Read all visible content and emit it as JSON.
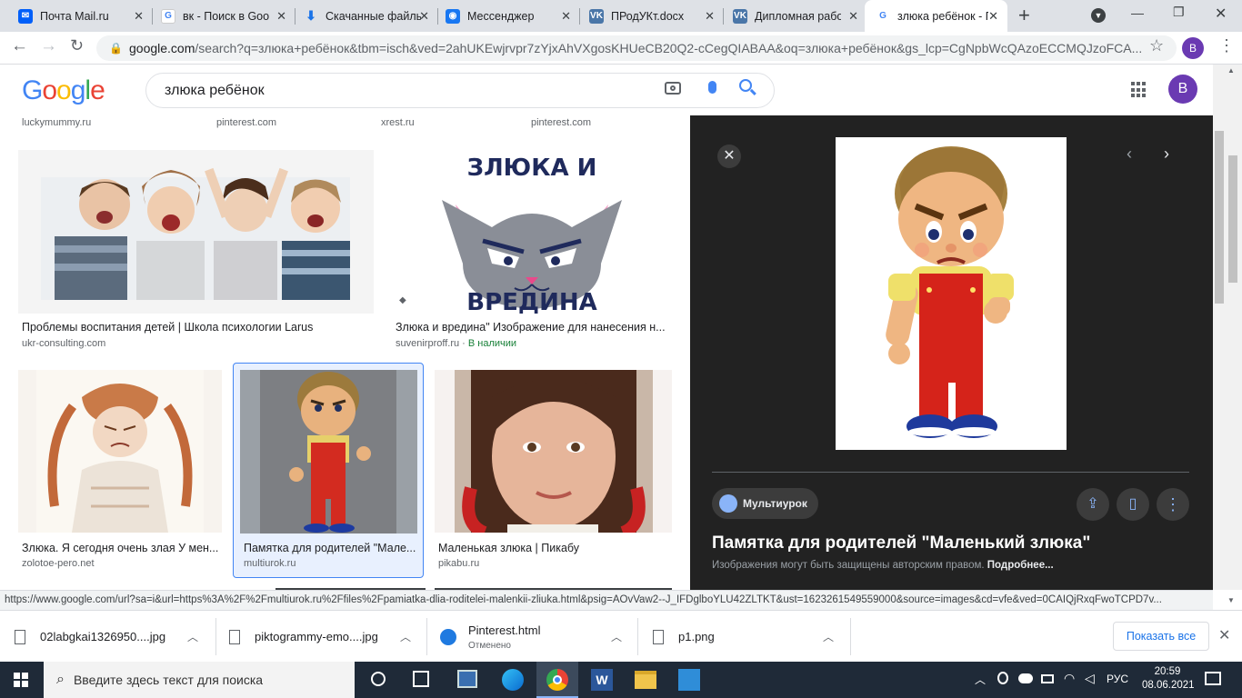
{
  "tabs": [
    {
      "title": "Почта Mail.ru",
      "icon": "mail-icon",
      "color": "#005ff9"
    },
    {
      "title": "вк - Поиск в Google",
      "icon": "google-icon",
      "color": "#4285f4"
    },
    {
      "title": "Скачанные файлы",
      "icon": "download-icon",
      "color": "#1a73e8"
    },
    {
      "title": "Мессенджер",
      "icon": "messenger-icon",
      "color": "#1877f2"
    },
    {
      "title": "ПРодУКт.docx",
      "icon": "vk-icon",
      "color": "#4a76a8"
    },
    {
      "title": "Дипломная работа",
      "icon": "vk-icon",
      "color": "#4a76a8"
    },
    {
      "title": "злюка ребёнок - Поиск в Google",
      "icon": "google-icon",
      "color": "#4285f4"
    }
  ],
  "address": {
    "host": "google.com",
    "path": "/search?q=злюка+ребёнок&tbm=isch&ved=2ahUKEwjrvpr7zYjxAhVXgosKHUeCB20Q2-cCegQIABAA&oq=злюка+ребёнок&gs_lcp=CgNpbWcQAzoECCMQJzoFCA..."
  },
  "profile_letter": "B",
  "google": {
    "logo": "Google",
    "query": "злюка ребёнок"
  },
  "top_sources": [
    "luckymummy.ru",
    "pinterest.com",
    "xrest.ru",
    "pinterest.com"
  ],
  "results": [
    {
      "caption": "Проблемы воспитания детей | Школа психологии Larus",
      "source": "ukr-consulting.com"
    },
    {
      "caption": "Злюка и вредина\" Изображение для нанесения н...",
      "source": "suvenirproff.ru",
      "badge": "В наличии"
    },
    {
      "caption": "Злюка. Я сегодня очень злая У мен...",
      "source": "zolotoe-pero.net"
    },
    {
      "caption": "Памятка для родителей \"Мале...",
      "source": "multiurok.ru"
    },
    {
      "caption": "Маленькая злюка | Пикабу",
      "source": "pikabu.ru"
    }
  ],
  "sticker_text": {
    "line1": "ЗЛЮКА И",
    "line2": "ВРЕДИНА"
  },
  "viewer": {
    "site_name": "Мультиурок",
    "title": "Памятка для родителей \"Маленький злюка\"",
    "copyright": "Изображения могут быть защищены авторским правом.",
    "more": "Подробнее..."
  },
  "status_url": "https://www.google.com/url?sa=i&url=https%3A%2F%2Fmultiurok.ru%2Ffiles%2Fpamiatka-dlia-roditelei-malenkii-zliuka.html&psig=AOvVaw2--J_IFDglboYLU42ZLTKT&ust=1623261549559000&source=images&cd=vfe&ved=0CAIQjRxqFwoTCPD7v...",
  "downloads": [
    {
      "name": "02labgkai1326950....jpg",
      "status": ""
    },
    {
      "name": "piktogrammy-emo....jpg",
      "status": ""
    },
    {
      "name": "Pinterest.html",
      "status": "Отменено"
    },
    {
      "name": "p1.png",
      "status": ""
    }
  ],
  "show_all": "Показать все",
  "taskbar": {
    "search_placeholder": "Введите здесь текст для поиска",
    "lang": "РУС",
    "time": "20:59",
    "date": "08.06.2021"
  }
}
